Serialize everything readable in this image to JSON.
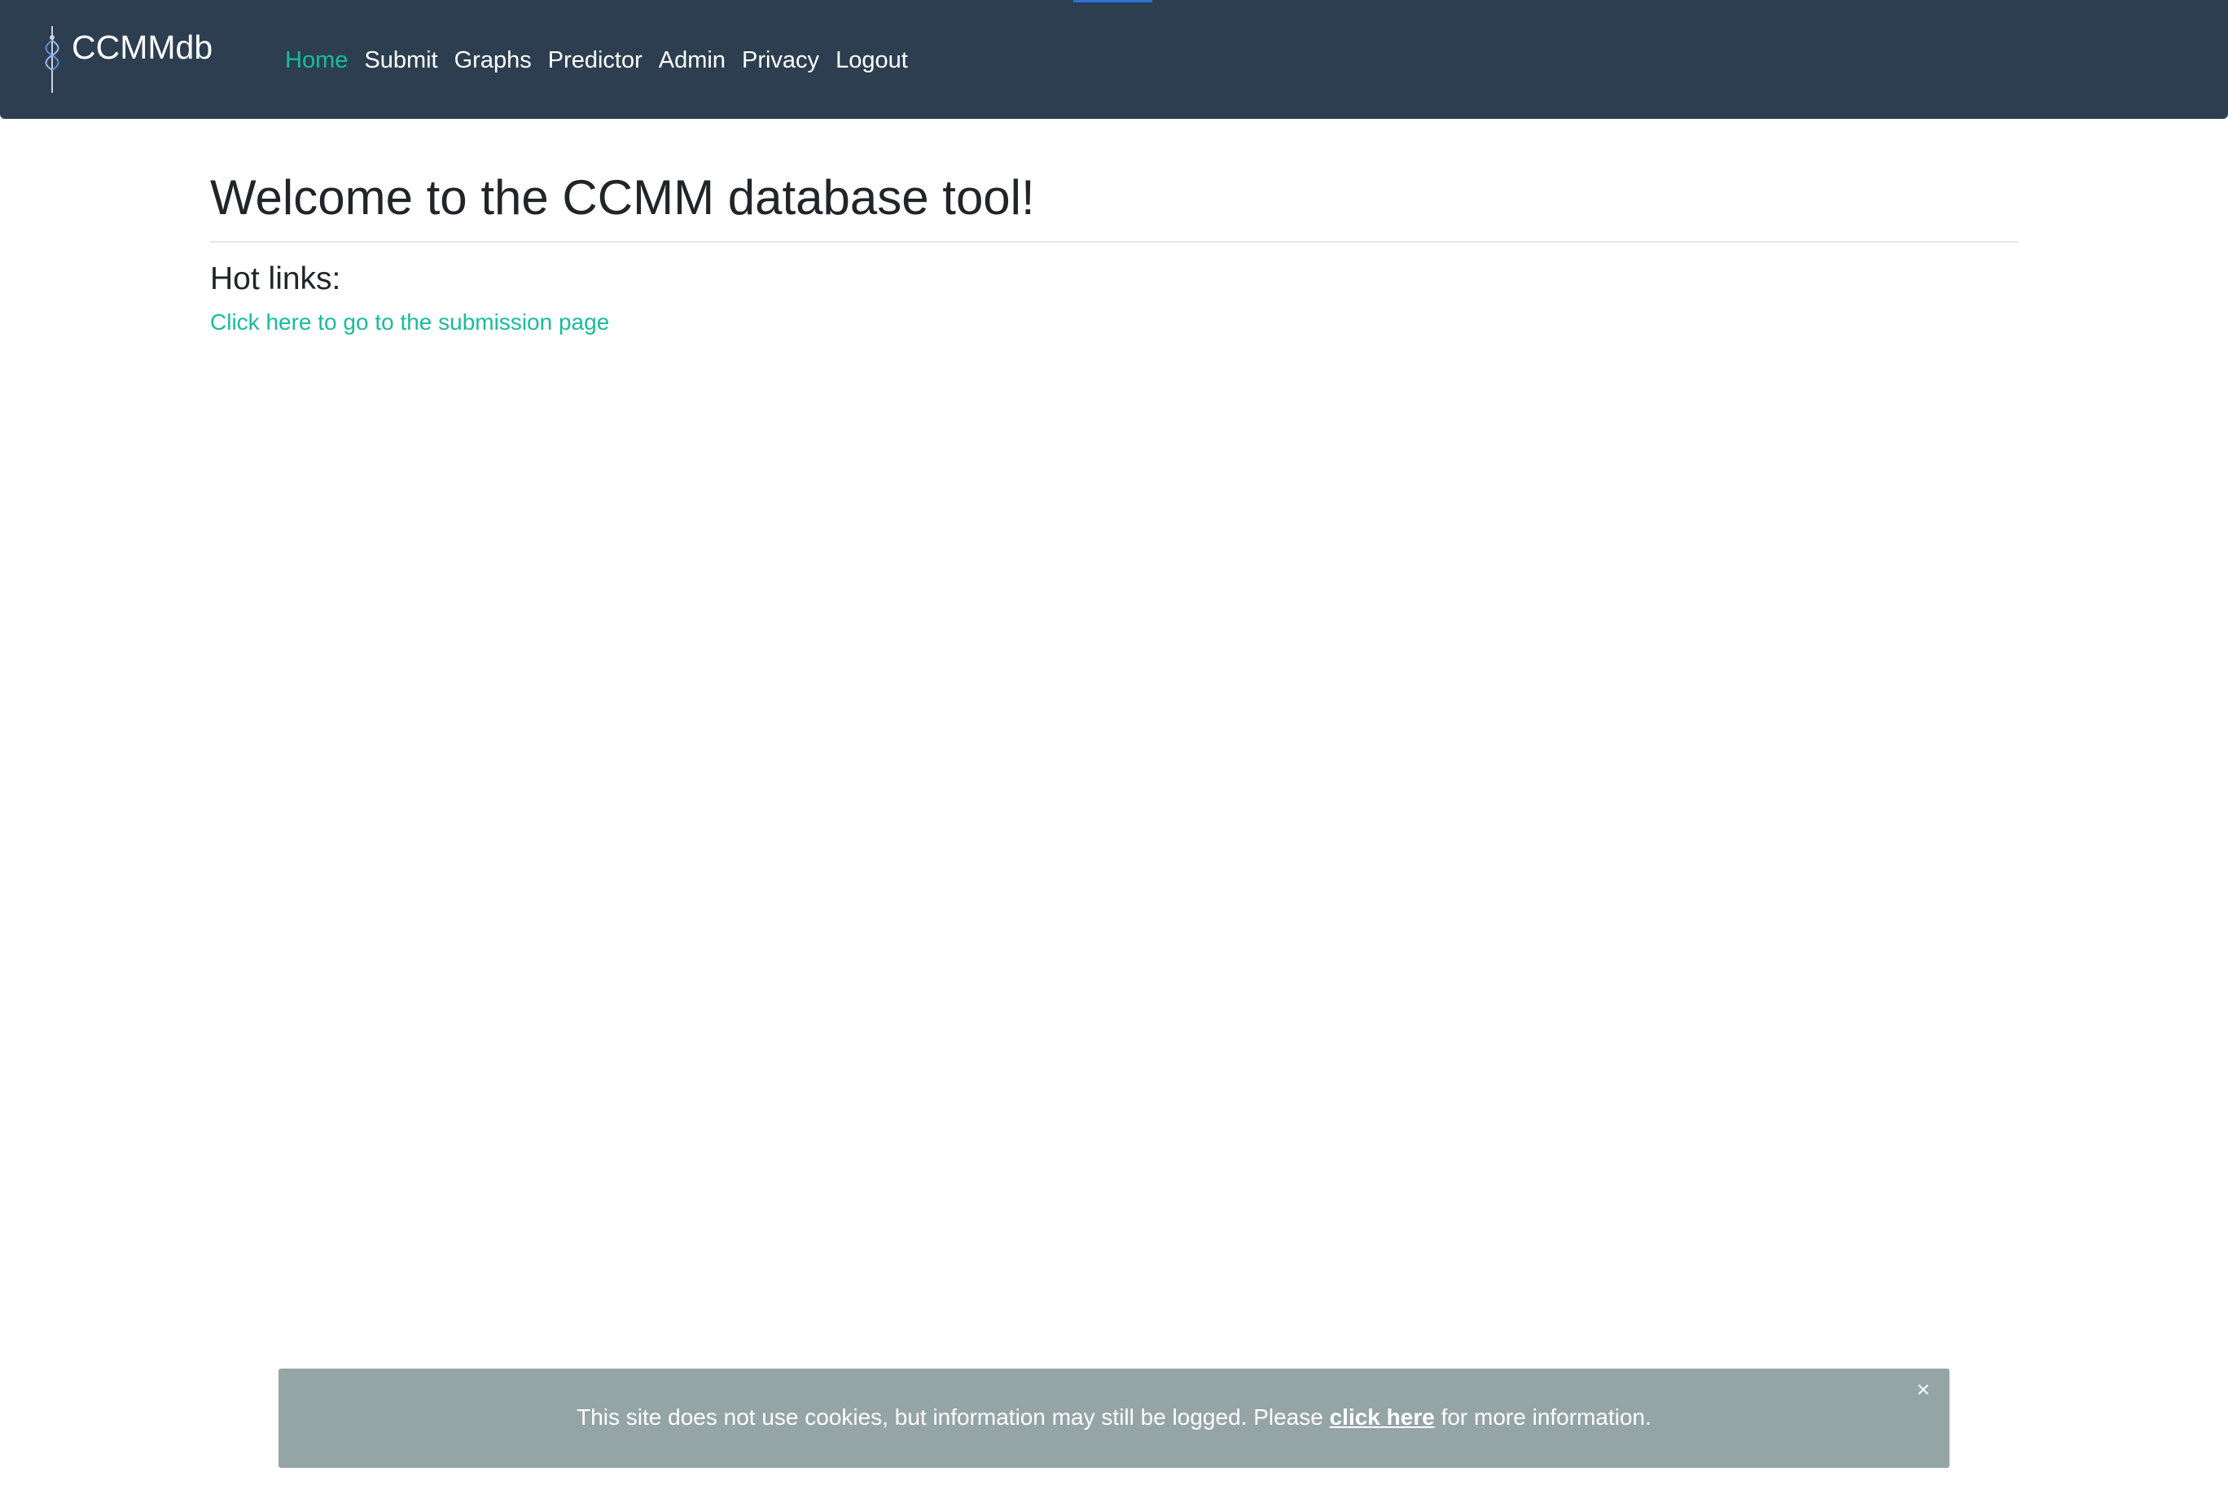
{
  "navbar": {
    "brand": "CCMMdb",
    "items": [
      {
        "label": "Home",
        "active": true
      },
      {
        "label": "Submit",
        "active": false
      },
      {
        "label": "Graphs",
        "active": false
      },
      {
        "label": "Predictor",
        "active": false
      },
      {
        "label": "Admin",
        "active": false
      },
      {
        "label": "Privacy",
        "active": false
      },
      {
        "label": "Logout",
        "active": false
      }
    ]
  },
  "main": {
    "title": "Welcome to the CCMM database tool!",
    "hot_links_heading": "Hot links:",
    "submission_link": "Click here to go to the submission page"
  },
  "cookie_banner": {
    "text_before": "This site does not use cookies, but information may still be logged. Please ",
    "link_text": "click here",
    "text_after": " for more information.",
    "close": "×"
  },
  "colors": {
    "navbar_bg": "#2c3e50",
    "accent": "#18bc9c",
    "banner_bg": "#95a5a6"
  },
  "icons": {
    "brand_logo": "caduceus-logo-icon",
    "close": "close-icon"
  }
}
